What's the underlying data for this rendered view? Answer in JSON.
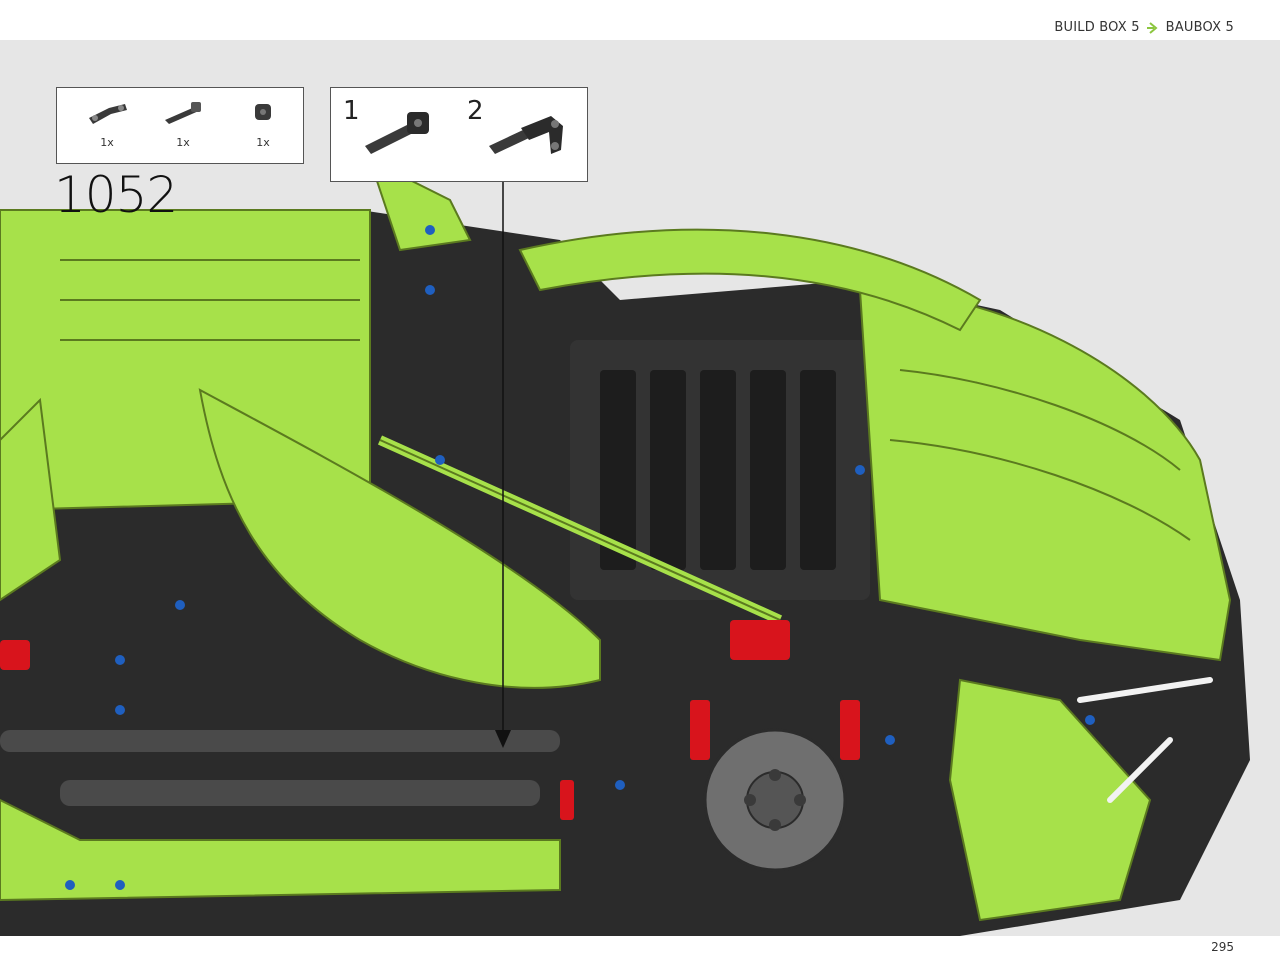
{
  "header": {
    "build_box_en": "BUILD BOX 5",
    "build_box_de": "BAUBOX 5",
    "accent_color": "#8cc63f"
  },
  "step": {
    "number": "1052",
    "parts": [
      {
        "icon": "liftarm-bent-icon",
        "qty": "1x",
        "color": "#3a3a3a"
      },
      {
        "icon": "axle-pin-icon",
        "qty": "1x",
        "color": "#3a3a3a"
      },
      {
        "icon": "bush-icon",
        "qty": "1x",
        "color": "#3a3a3a"
      }
    ],
    "subassembly": {
      "step1_label": "1",
      "step2_label": "2"
    }
  },
  "model": {
    "body_color": "#a7e14a",
    "frame_color": "#2b2b2b",
    "accent_red": "#d8141c",
    "pin_blue": "#1f5fbf",
    "hub_gray": "#6f6f6f"
  },
  "footer": {
    "page_number": "295"
  }
}
